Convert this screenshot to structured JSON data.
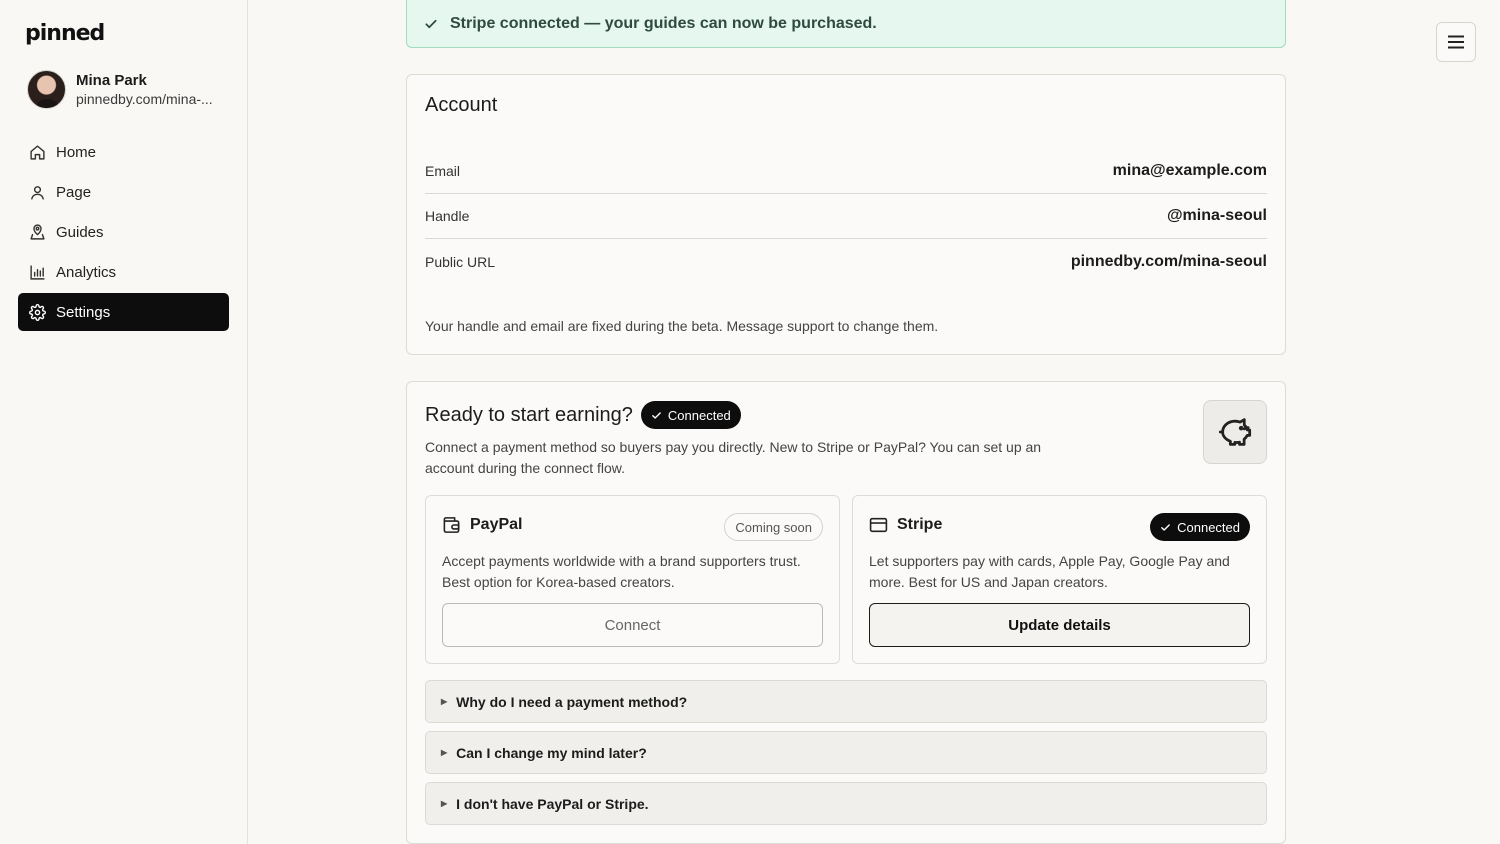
{
  "brand": {
    "logo": "pinned"
  },
  "profile": {
    "name": "Mina Park",
    "url": "pinnedby.com/mina-..."
  },
  "nav": {
    "items": [
      {
        "label": "Home",
        "icon": "home-icon"
      },
      {
        "label": "Page",
        "icon": "user-icon"
      },
      {
        "label": "Guides",
        "icon": "map-pin-icon"
      },
      {
        "label": "Analytics",
        "icon": "bar-chart-icon"
      },
      {
        "label": "Settings",
        "icon": "gear-icon",
        "active": true
      }
    ]
  },
  "toast": {
    "message": "Stripe connected — your guides can now be purchased."
  },
  "account": {
    "title": "Account",
    "rows": [
      {
        "label": "Email",
        "value": "mina@example.com"
      },
      {
        "label": "Handle",
        "value": "@mina-seoul"
      },
      {
        "label": "Public URL",
        "value": "pinnedby.com/mina-seoul"
      }
    ],
    "note": "Your handle and email are fixed during the beta. Message support to change them."
  },
  "earning": {
    "title": "Ready to start earning?",
    "status_badge": "Connected",
    "description": "Connect a payment method so buyers pay you directly. New to Stripe or PayPal? You can set up an account during the connect flow.",
    "icon": "piggy-bank-icon",
    "providers": {
      "paypal": {
        "name": "PayPal",
        "badge": "Coming soon",
        "description": "Accept payments worldwide with a brand supporters trust. Best option for Korea-based creators.",
        "button": "Connect"
      },
      "stripe": {
        "name": "Stripe",
        "badge": "Connected",
        "description": "Let supporters pay with cards, Apple Pay, Google Pay and more. Best for US and Japan creators.",
        "button": "Update details"
      }
    },
    "faq": [
      "Why do I need a payment method?",
      "Can I change my mind later?",
      "I don't have PayPal or Stripe."
    ]
  },
  "colors": {
    "accent_dark": "#0d0d0d",
    "success_bg": "#e5f7ef",
    "success_border": "#9fdcc0",
    "page_bg": "#f9f8f5"
  }
}
